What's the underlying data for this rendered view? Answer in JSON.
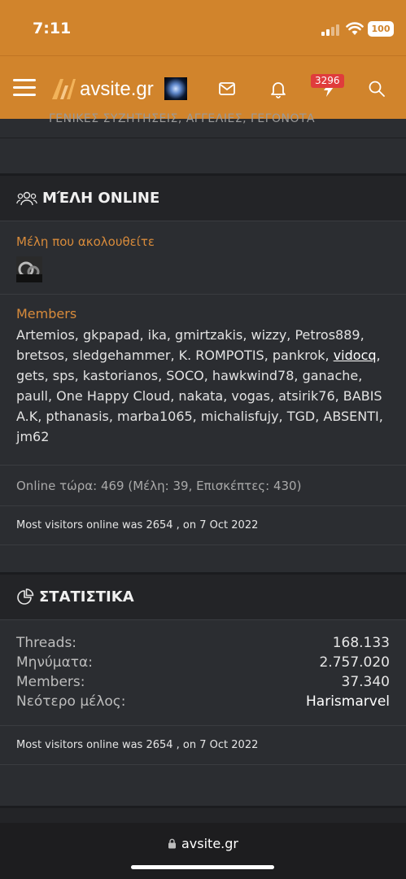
{
  "status_bar": {
    "time": "7:11",
    "battery": "100"
  },
  "header": {
    "logo_text": "avsite.gr",
    "notification_badge": "3296"
  },
  "top_strip": {
    "cut_text": "ΓΕΝΙΚΕΣ ΣΥΖΗΤΗΣΕΙΣ, ΑΓΓΕΛΙΕΣ, ΓΕΓΟΝΟΤΑ"
  },
  "online_members": {
    "title": "ΜΈΛΗ ONLINE",
    "following_label": "Μέλη που ακολουθείτε",
    "members_label": "Members",
    "members_before": "Artemios, gkpapad, ika, gmirtzakis, wizzy, Petros889, bretsos, sledgehammer, K. ROMPOTIS, pankrok,",
    "highlighted_member": "vidocq",
    "members_after": ", gets, sps, kastorianos, SOCO, hawkwind78, ganache, paull, One Happy Cloud, nakata, vogas, atsirik76, BABIS A.K, pthanasis, marba1065, michalisfujy, TGD, ABSENTI, jm62",
    "online_now": "Online τώρα: 469 (Μέλη: 39, Επισκέπτες: 430)",
    "most_visitors": "Most visitors online was 2654 , on 7 Oct 2022"
  },
  "statistics": {
    "title": "ΣΤΑΤΙΣΤΙΚΑ",
    "rows": [
      {
        "label": "Threads:",
        "value": "168.133"
      },
      {
        "label": "Μηνύματα:",
        "value": "2.757.020"
      },
      {
        "label": "Members:",
        "value": "37.340"
      },
      {
        "label": "Νεότερο μέλος:",
        "value": "Harismarvel"
      }
    ],
    "most_visitors": "Most visitors online was 2654 , on 7 Oct 2022"
  },
  "browser": {
    "url": "avsite.gr"
  },
  "colors": {
    "brand_orange": "#d1842c",
    "accent_label": "#d88b3b",
    "badge_red": "#e03c3c"
  }
}
